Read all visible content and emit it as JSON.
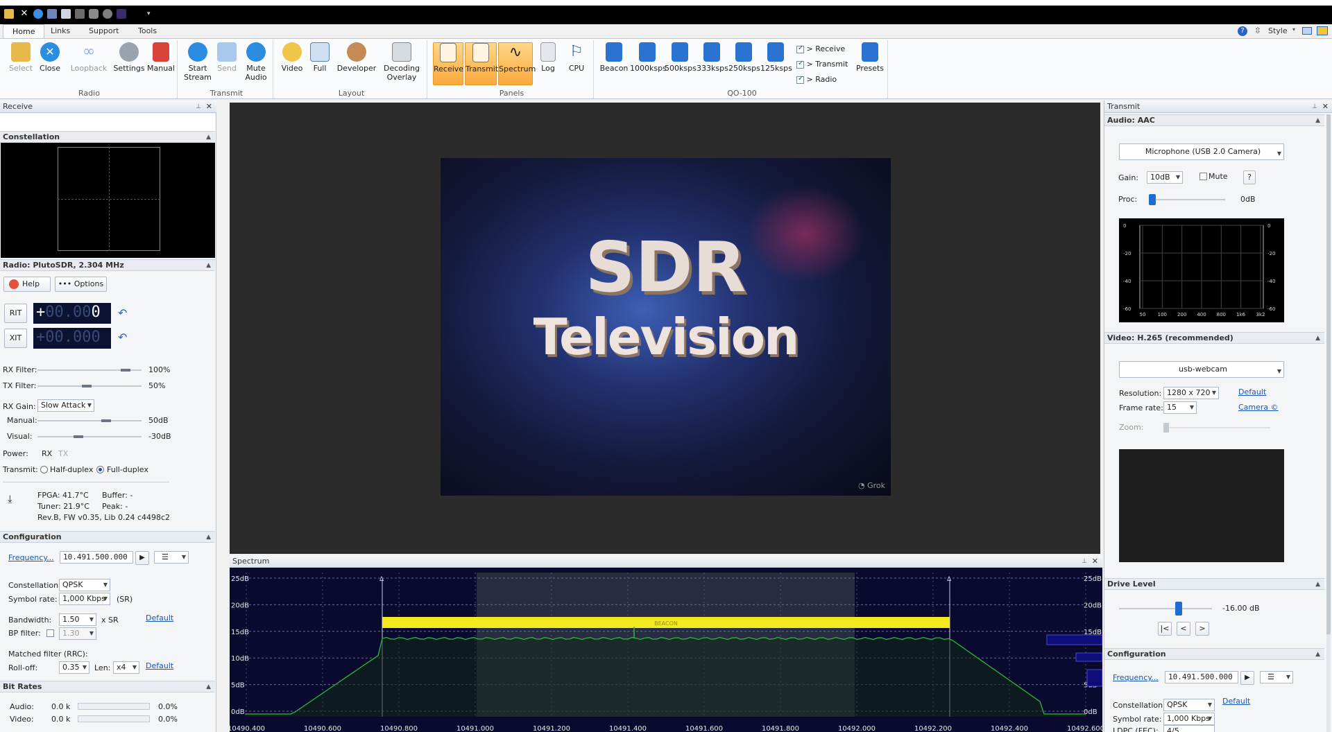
{
  "window_controls": {
    "style_label": "Style"
  },
  "ribbon": {
    "tabs": [
      "Home",
      "Links",
      "Support",
      "Tools"
    ],
    "groups": {
      "radio": {
        "label": "Radio",
        "buttons": [
          "Select",
          "Close",
          "Loopback",
          "Settings",
          "Manual"
        ]
      },
      "transmit": {
        "label": "Transmit",
        "buttons": [
          "Start\nStream",
          "Send",
          "Mute\nAudio"
        ]
      },
      "layout": {
        "label": "Layout",
        "buttons": [
          "Video",
          "Full",
          "Developer",
          "Decoding\nOverlay"
        ]
      },
      "panels": {
        "label": "Panels",
        "buttons": [
          "Receive",
          "Transmit",
          "Spectrum",
          "Log",
          "CPU"
        ]
      },
      "qo100": {
        "label": "QO-100",
        "buttons": [
          "Beacon",
          "1000ksps",
          "500ksps",
          "333ksps",
          "250ksps",
          "125ksps"
        ],
        "checks": [
          "> Receive",
          "> Transmit",
          "> Radio"
        ],
        "presets_label": "Presets"
      }
    }
  },
  "receive_panel": {
    "title": "Receive",
    "constellation": {
      "title": "Constellation"
    },
    "radio": {
      "title": "Radio: PlutoSDR, 2.304 MHz",
      "help_label": "Help",
      "options_label": "Options",
      "rit_label": "RIT",
      "xit_label": "XIT",
      "rit_value": {
        "sign": "+",
        "dim": "00.00",
        "last": "0"
      },
      "xit_value": {
        "sign": "+",
        "dim": "00.000",
        "last": ""
      },
      "rx_filter": {
        "label": "RX Filter:",
        "value": "100%"
      },
      "tx_filter": {
        "label": "TX Filter:",
        "value": "50%"
      },
      "rx_gain": {
        "label": "RX Gain:",
        "value": "Slow Attack"
      },
      "manual": {
        "label": "Manual:",
        "value": "50dB"
      },
      "visual": {
        "label": "Visual:",
        "value": "-30dB"
      },
      "power": {
        "label": "Power:",
        "rx": "RX",
        "tx": "TX"
      },
      "transmit": {
        "label": "Transmit:",
        "half": "Half-duplex",
        "full": "Full-duplex"
      },
      "fpga": "FPGA: 41.7°C",
      "tuner": "Tuner: 21.9°C",
      "buffer": "Buffer: -",
      "peak": "Peak: -",
      "rev": "Rev.B, FW v0.35, Lib 0.24 c4498c2"
    },
    "configuration": {
      "title": "Configuration",
      "frequency_link": "Frequency...",
      "frequency_value": "10.491.500.000",
      "constellation_label": "Constellation:",
      "constellation_value": "QPSK",
      "symbol_rate_label": "Symbol rate:",
      "symbol_rate_value": "1,000 Kbps",
      "symbol_rate_unit": "(SR)",
      "bandwidth_label": "Bandwidth:",
      "bandwidth_value": "1.50",
      "bandwidth_unit": "x SR",
      "default_link": "Default",
      "bp_filter_label": "BP filter:",
      "bp_filter_value": "1.30",
      "matched_filter_label": "Matched filter (RRC):",
      "rolloff_label": "Roll-off:",
      "rolloff_value": "0.35",
      "len_label": "Len:",
      "len_value": "x4",
      "default_link2": "Default"
    },
    "bitrates": {
      "title": "Bit Rates",
      "rows": [
        {
          "label": "Audio:",
          "value": "0.0 k",
          "pct": "0.0%"
        },
        {
          "label": "Video:",
          "value": "0.0 k",
          "pct": "0.0%"
        }
      ]
    }
  },
  "video": {
    "title_line1": "SDR",
    "title_line2": "Television",
    "watermark": "Grok"
  },
  "spectrum": {
    "title": "Spectrum",
    "db_labels": [
      "25dB",
      "20dB",
      "15dB",
      "10dB",
      "5dB",
      "0dB"
    ],
    "freq_labels": [
      "10490.400",
      "10490.600",
      "10490.800",
      "10491.000",
      "10491.200",
      "10491.400",
      "10491.600",
      "10491.800",
      "10492.000",
      "10492.200",
      "10492.400",
      "10492.600"
    ],
    "beacon_label": "BEACON"
  },
  "transmit_panel": {
    "title": "Transmit",
    "audio": {
      "title": "Audio: AAC",
      "device": "Microphone (USB 2.0 Camera)",
      "gain_label": "Gain:",
      "gain_value": "10dB",
      "mute_label": "Mute",
      "help_q": "?",
      "proc_label": "Proc:",
      "proc_value": "0dB",
      "eq_y_labels": [
        "0",
        "-20",
        "-40",
        "-60"
      ],
      "eq_x_labels": [
        "50",
        "100",
        "200",
        "400",
        "800",
        "1k6",
        "3k2"
      ]
    },
    "video": {
      "title": "Video: H.265 (recommended)",
      "device": "usb-webcam",
      "resolution_label": "Resolution:",
      "resolution_value": "1280 x 720",
      "default_link": "Default",
      "framerate_label": "Frame rate:",
      "framerate_value": "15",
      "camera_link": "Camera ©",
      "zoom_label": "Zoom:"
    },
    "drive": {
      "title": "Drive Level",
      "value": "-16.00 dB",
      "btn_first": "|<",
      "btn_prev": "<",
      "btn_next": ">"
    },
    "configuration": {
      "title": "Configuration",
      "frequency_link": "Frequency...",
      "frequency_value": "10.491.500.000",
      "constellation_label": "Constellation:",
      "constellation_value": "QPSK",
      "default_link": "Default",
      "symbol_rate_label": "Symbol rate:",
      "symbol_rate_value": "1,000 Kbps",
      "ldpc_label": "LDPC (FEC):",
      "ldpc_value": "4/5"
    }
  }
}
